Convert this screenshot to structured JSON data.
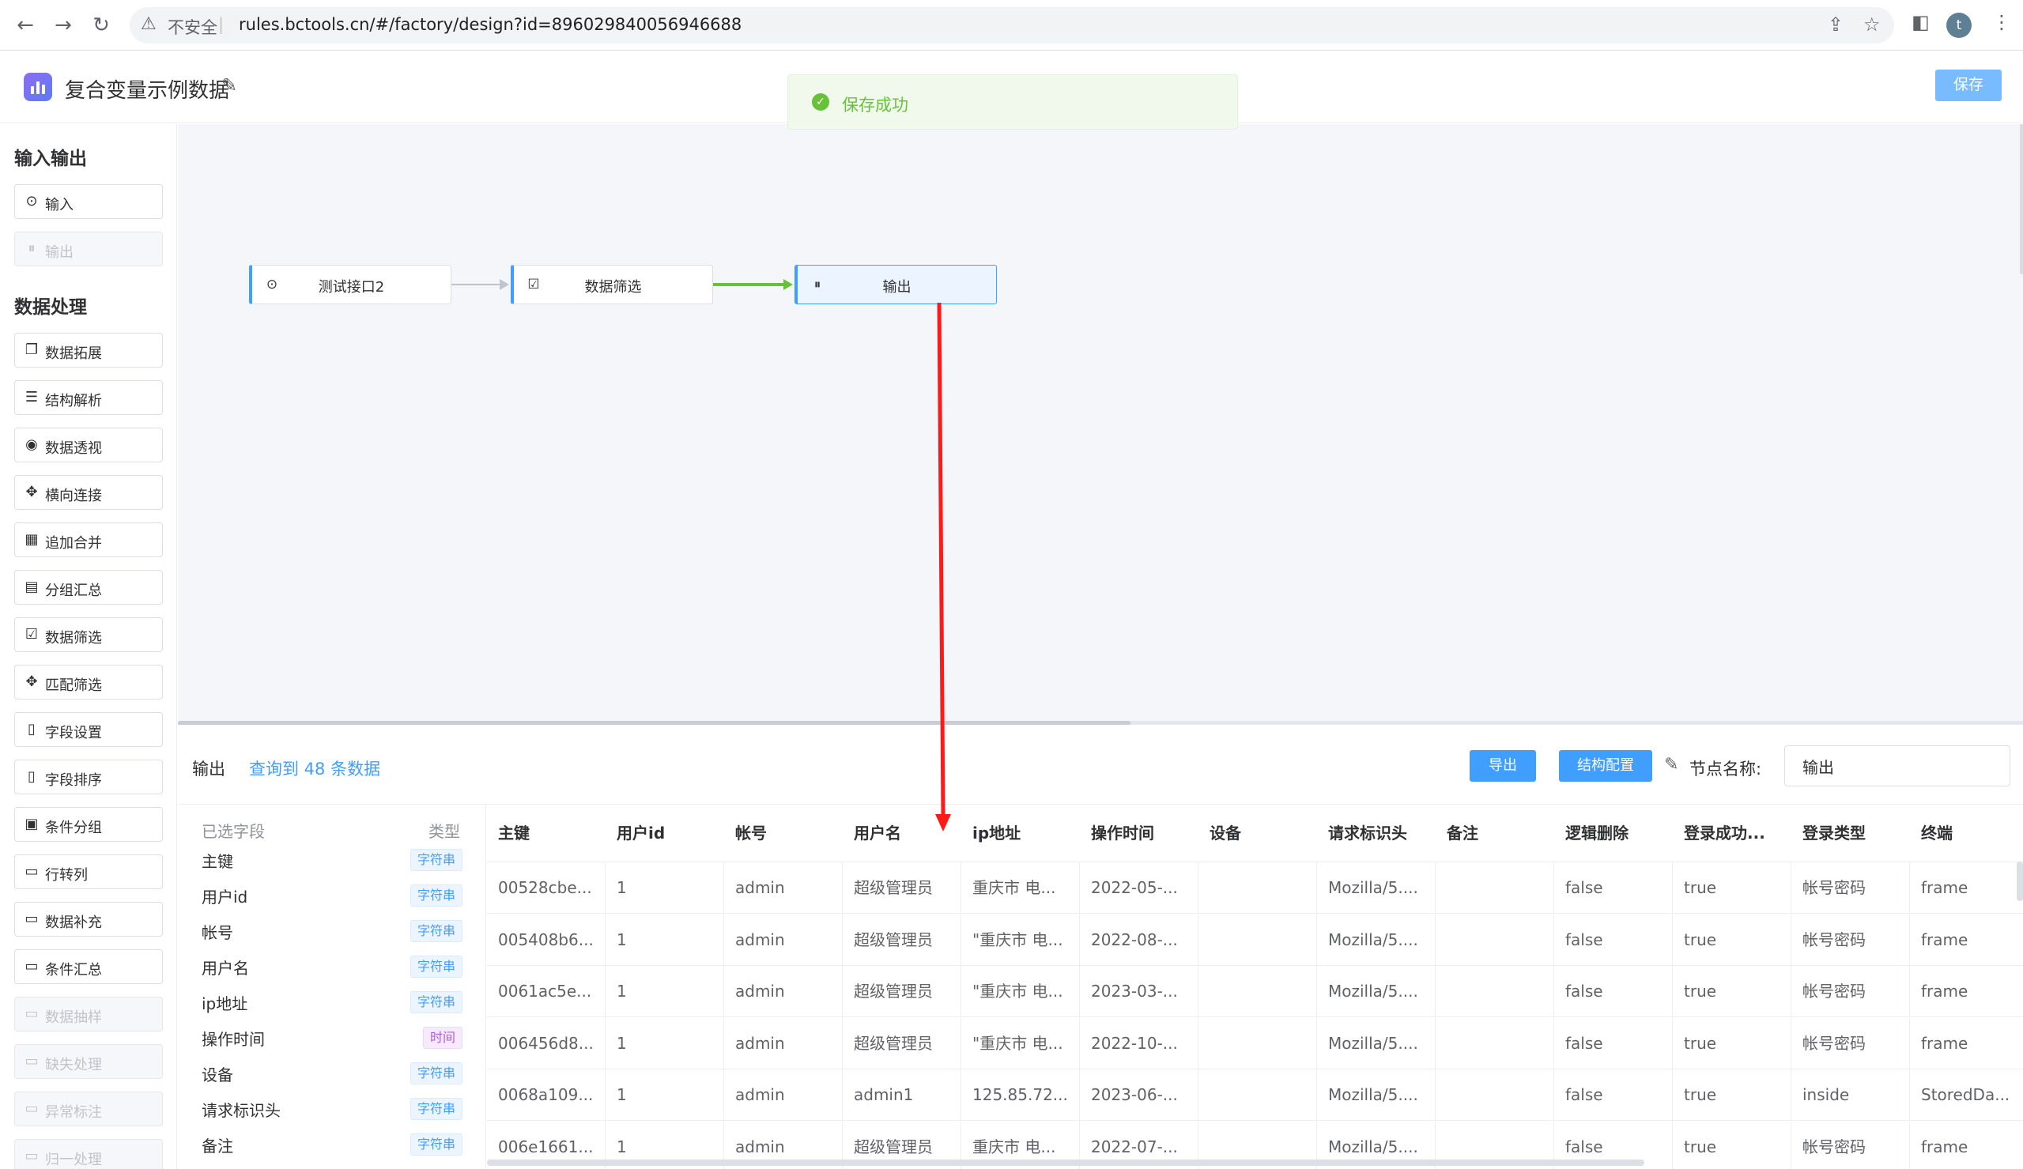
{
  "browser": {
    "insecure_label": "不安全",
    "separator": "|",
    "url": "rules.bctools.cn/#/factory/design?id=896029840056946688",
    "profile_initial": "t"
  },
  "header": {
    "title": "复合变量示例数据",
    "save_label": "保存",
    "toast": "保存成功"
  },
  "sidebar": {
    "sections": [
      {
        "title": "输入输出",
        "items": [
          {
            "label": "输入",
            "icon": "play-circle-icon",
            "disabled": false
          },
          {
            "label": "输出",
            "icon": "pause-circle-icon",
            "disabled": true
          }
        ]
      },
      {
        "title": "数据处理",
        "items": [
          {
            "label": "数据拓展",
            "icon": "copy-icon",
            "disabled": false
          },
          {
            "label": "结构解析",
            "icon": "sliders-icon",
            "disabled": false
          },
          {
            "label": "数据透视",
            "icon": "eye-icon",
            "disabled": false
          },
          {
            "label": "横向连接",
            "icon": "move-icon",
            "disabled": false
          },
          {
            "label": "追加合并",
            "icon": "calendar-icon",
            "disabled": false
          },
          {
            "label": "分组汇总",
            "icon": "document-icon",
            "disabled": false
          },
          {
            "label": "数据筛选",
            "icon": "file-check-icon",
            "disabled": false
          },
          {
            "label": "匹配筛选",
            "icon": "move-icon",
            "disabled": false
          },
          {
            "label": "字段设置",
            "icon": "file-icon",
            "disabled": false
          },
          {
            "label": "字段排序",
            "icon": "file-icon",
            "disabled": false
          },
          {
            "label": "条件分组",
            "icon": "grid-icon",
            "disabled": false
          },
          {
            "label": "行转列",
            "icon": "box-icon",
            "disabled": false
          },
          {
            "label": "数据补充",
            "icon": "box-icon",
            "disabled": false
          },
          {
            "label": "条件汇总",
            "icon": "box-icon",
            "disabled": false
          },
          {
            "label": "数据抽样",
            "icon": "box-icon",
            "disabled": true
          },
          {
            "label": "缺失处理",
            "icon": "box-icon",
            "disabled": true
          },
          {
            "label": "异常标注",
            "icon": "box-icon",
            "disabled": true
          },
          {
            "label": "归一处理",
            "icon": "box-icon",
            "disabled": true
          }
        ]
      }
    ]
  },
  "flow": {
    "nodes": [
      {
        "label": "测试接口2",
        "icon": "play-circle-icon",
        "active": false
      },
      {
        "label": "数据筛选",
        "icon": "file-check-icon",
        "active": false
      },
      {
        "label": "输出",
        "icon": "pause-circle-icon",
        "active": true
      }
    ],
    "edge_colors": [
      "#c0c4cc",
      "#67c23a"
    ]
  },
  "panel": {
    "node_name": "输出",
    "query_count": "查询到 48 条数据",
    "export_label": "导出",
    "struct_label": "结构配置",
    "node_name_label": "节点名称:",
    "node_name_value": "输出",
    "fields_header": "已选字段",
    "type_header": "类型",
    "fields": [
      {
        "name": "主键",
        "type": "字符串",
        "kind": "str"
      },
      {
        "name": "用户id",
        "type": "字符串",
        "kind": "str"
      },
      {
        "name": "帐号",
        "type": "字符串",
        "kind": "str"
      },
      {
        "name": "用户名",
        "type": "字符串",
        "kind": "str"
      },
      {
        "name": "ip地址",
        "type": "字符串",
        "kind": "str"
      },
      {
        "name": "操作时间",
        "type": "时间",
        "kind": "time"
      },
      {
        "name": "设备",
        "type": "字符串",
        "kind": "str"
      },
      {
        "name": "请求标识头",
        "type": "字符串",
        "kind": "str"
      },
      {
        "name": "备注",
        "type": "字符串",
        "kind": "str"
      }
    ],
    "columns": [
      "主键",
      "用户id",
      "帐号",
      "用户名",
      "ip地址",
      "操作时间",
      "设备",
      "请求标识头",
      "备注",
      "逻辑删除",
      "登录成功...",
      "登录类型",
      "终端"
    ],
    "rows": [
      [
        "00528cbe...",
        "1",
        "admin",
        "超级管理员",
        "重庆市 电...",
        "2022-05-...",
        "",
        "Mozilla/5....",
        "",
        "false",
        "true",
        "帐号密码",
        "frame"
      ],
      [
        "005408b6...",
        "1",
        "admin",
        "超级管理员",
        "\"重庆市 电...",
        "2022-08-...",
        "",
        "Mozilla/5....",
        "",
        "false",
        "true",
        "帐号密码",
        "frame"
      ],
      [
        "0061ac5e...",
        "1",
        "admin",
        "超级管理员",
        "\"重庆市 电...",
        "2023-03-...",
        "",
        "Mozilla/5....",
        "",
        "false",
        "true",
        "帐号密码",
        "frame"
      ],
      [
        "006456d8...",
        "1",
        "admin",
        "超级管理员",
        "\"重庆市 电...",
        "2022-10-...",
        "",
        "Mozilla/5....",
        "",
        "false",
        "true",
        "帐号密码",
        "frame"
      ],
      [
        "0068a109...",
        "1",
        "admin",
        "admin1",
        "125.85.72...",
        "2023-06-...",
        "",
        "Mozilla/5....",
        "",
        "false",
        "true",
        "inside",
        "StoredDa..."
      ],
      [
        "006e1661...",
        "1",
        "admin",
        "超级管理员",
        "重庆市 电...",
        "2022-07-...",
        "",
        "Mozilla/5....",
        "",
        "false",
        "true",
        "帐号密码",
        "frame"
      ]
    ]
  },
  "colors": {
    "primary": "#409eff",
    "success": "#67c23a",
    "annotation_arrow": "#ff1a1a"
  }
}
